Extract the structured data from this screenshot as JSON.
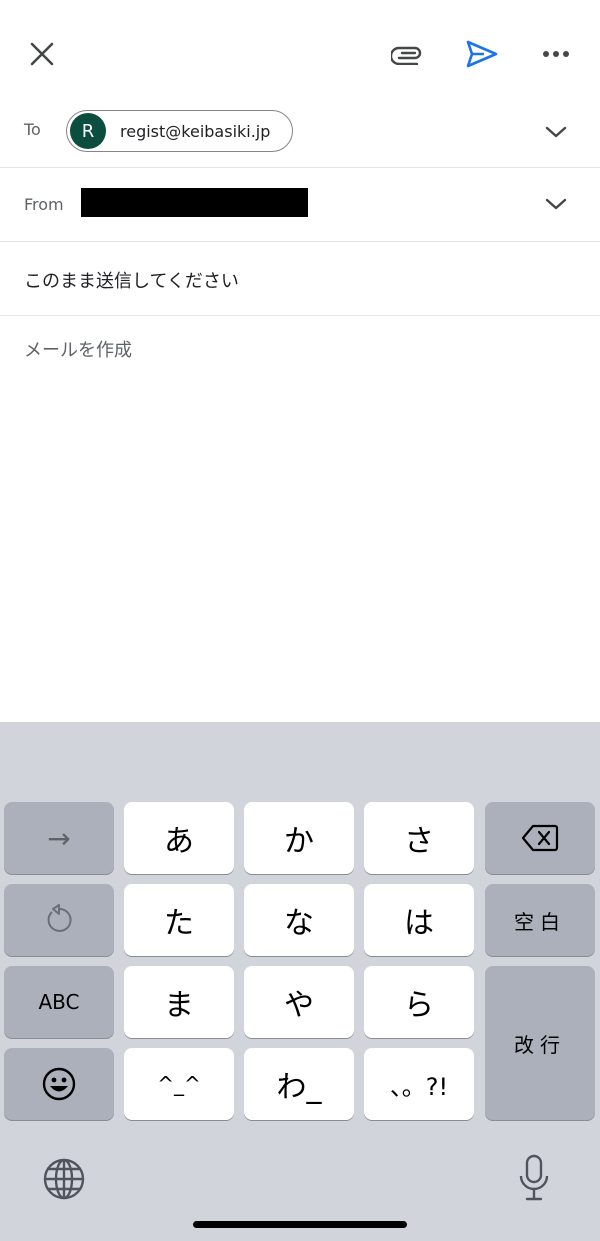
{
  "toolbar": {
    "close": "close-icon",
    "attach": "paperclip-icon",
    "send": "send-icon",
    "more": "more-horiz-icon",
    "accent_color": "#1a73e8"
  },
  "to": {
    "label": "To",
    "chip": {
      "initial": "R",
      "email": "regist@keibasiki.jp",
      "avatar_color": "#0b4d3e"
    }
  },
  "from": {
    "label": "From"
  },
  "subject": {
    "value": "このまま送信してください"
  },
  "body": {
    "placeholder": "メールを作成"
  },
  "keyboard": {
    "rows": [
      [
        "→",
        "あ",
        "か",
        "さ",
        "⌫"
      ],
      [
        "↺",
        "た",
        "な",
        "は",
        "空白"
      ],
      [
        "ABC",
        "ま",
        "や",
        "ら",
        "改行"
      ],
      [
        "😀",
        "^_^",
        "わ_",
        "、。?!"
      ]
    ],
    "keys": {
      "arrow": "→",
      "a": "あ",
      "ka": "か",
      "sa": "さ",
      "undo": "↺",
      "ta": "た",
      "na": "な",
      "ha": "は",
      "space": "空白",
      "abc": "ABC",
      "ma": "ま",
      "ya": "や",
      "ra": "ら",
      "return": "改行",
      "emoji": "😀",
      "kaomoji": "^_^",
      "wa": "わ_",
      "punct": "、。?!"
    },
    "globe": "globe-icon",
    "mic": "microphone-icon"
  }
}
